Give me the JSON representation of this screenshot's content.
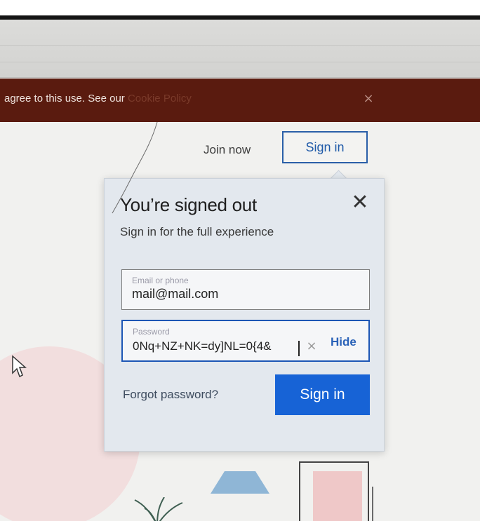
{
  "cookie_banner": {
    "text": "agree to this use. See our",
    "link_label": "Cookie Policy",
    "close_icon": "×"
  },
  "header": {
    "join_now": "Join now",
    "sign_in": "Sign in"
  },
  "flyout": {
    "title": "You’re signed out",
    "subtitle": "Sign in for the full experience",
    "close_icon": "✕",
    "email": {
      "label": "Email or phone",
      "value": "mail@mail.com"
    },
    "password": {
      "label": "Password",
      "value": "0Nq+NZ+NK=dy]NL=0{4&",
      "clear_icon": "×",
      "hide_label": "Hide"
    },
    "forgot_password": "Forgot password?",
    "sign_in_button": "Sign in"
  },
  "colors": {
    "banner_bg": "#5a1b0f",
    "primary_blue": "#1763d6",
    "link_blue": "#2a62b8"
  }
}
